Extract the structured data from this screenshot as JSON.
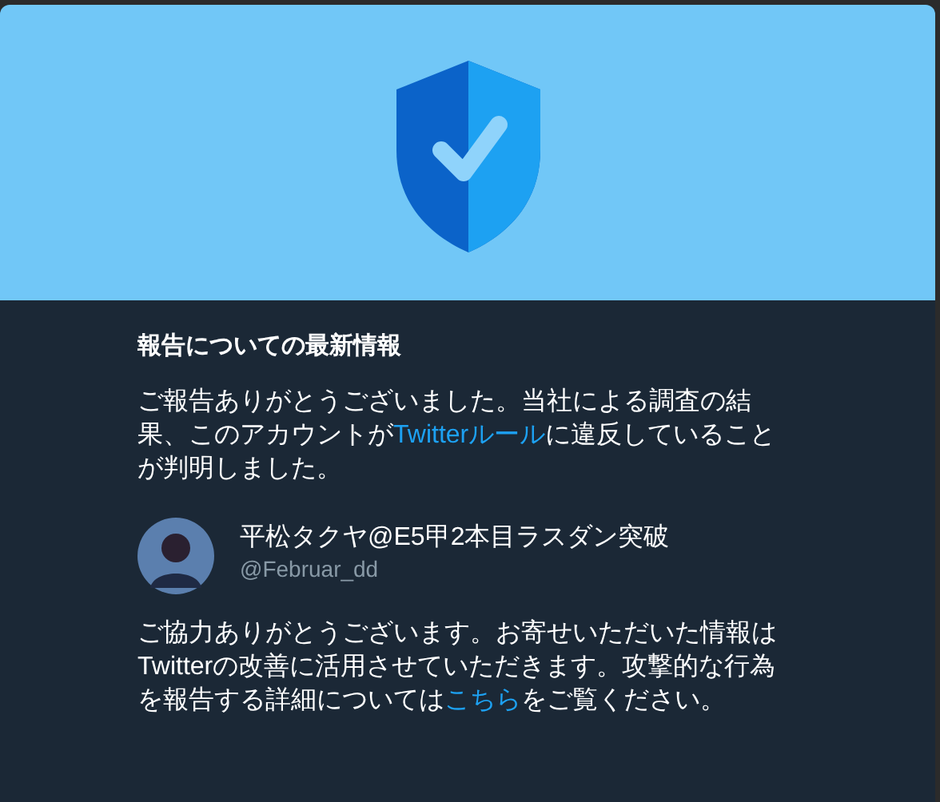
{
  "title": "報告についての最新情報",
  "message": {
    "before": "ご報告ありがとうございました。当社による調査の結果、このアカウントが",
    "link": "Twitterルール",
    "after": "に違反していることが判明しました。"
  },
  "account": {
    "name": "平松タクヤ@E5甲2本目ラスダン突破",
    "handle": "@Februar_dd"
  },
  "footer": {
    "before": "ご協力ありがとうございます。お寄せいただいた情報はTwitterの改善に活用させていただきます。攻撃的な行為を報告する詳細については",
    "link": "こちら",
    "after": "をご覧ください。"
  }
}
